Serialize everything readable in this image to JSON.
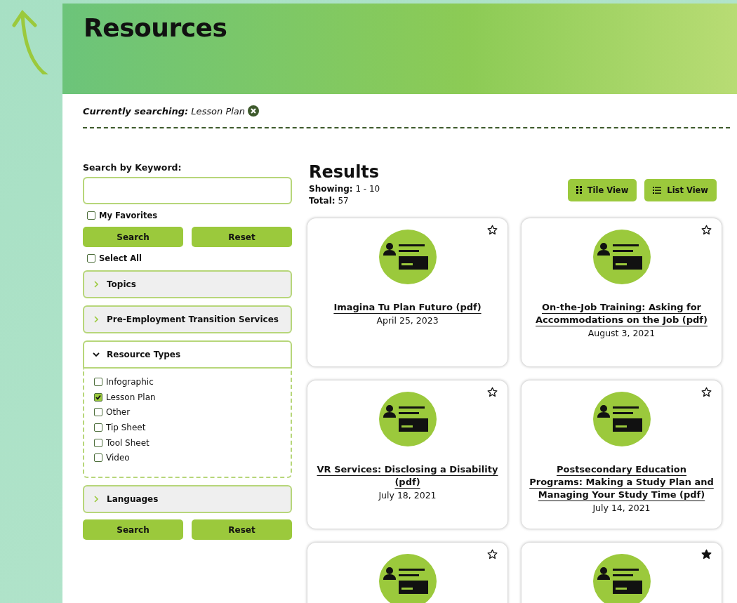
{
  "header": {
    "title": "Resources"
  },
  "current_search": {
    "label": "Currently searching:",
    "value": "Lesson Plan"
  },
  "sidebar": {
    "keyword_label": "Search by Keyword:",
    "favorites": {
      "label": "My Favorites",
      "checked": false
    },
    "buttons": [
      "Search",
      "Reset"
    ],
    "select_all": {
      "label": "Select All",
      "checked": false
    },
    "accordions": [
      {
        "label": "Topics",
        "expanded": false
      },
      {
        "label": "Pre-Employment Transition Services",
        "expanded": false
      },
      {
        "label": "Resource Types",
        "expanded": true,
        "options": [
          {
            "label": "Infographic",
            "checked": false
          },
          {
            "label": "Lesson Plan",
            "checked": true
          },
          {
            "label": "Other",
            "checked": false
          },
          {
            "label": "Tip Sheet",
            "checked": false
          },
          {
            "label": "Tool Sheet",
            "checked": false
          },
          {
            "label": "Video",
            "checked": false
          }
        ]
      },
      {
        "label": "Languages",
        "expanded": false
      }
    ],
    "bottom_buttons": [
      "Search",
      "Reset"
    ]
  },
  "results": {
    "title": "Results",
    "showing_label": "Showing:",
    "showing": "1 - 10",
    "total_label": "Total:",
    "total": "57",
    "views": [
      "Tile View",
      "List View"
    ],
    "cards": [
      {
        "title": "Imagina Tu Plan Futuro (pdf)",
        "date": "April 25, 2023",
        "favorite": false
      },
      {
        "title": "On-the-Job Training: Asking for Accommodations on the Job (pdf)",
        "date": "August 3, 2021",
        "favorite": false
      },
      {
        "title": "VR Services: Disclosing a Disability (pdf)",
        "date": "July 18, 2021",
        "favorite": false
      },
      {
        "title": "Postsecondary Education Programs: Making a Study Plan and Managing Your Study Time (pdf)",
        "date": "July 14, 2021",
        "favorite": false
      },
      {
        "favorite": false
      },
      {
        "favorite": true
      }
    ]
  }
}
